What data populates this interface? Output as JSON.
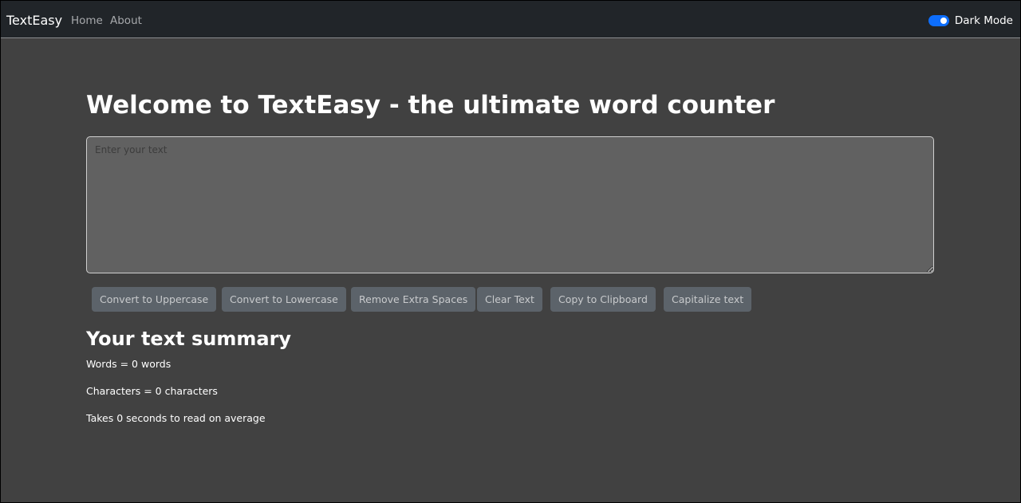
{
  "navbar": {
    "brand": "TextEasy",
    "links": [
      "Home",
      "About"
    ],
    "dark_mode": {
      "label": "Dark Mode",
      "enabled": true
    }
  },
  "main": {
    "title": "Welcome to TextEasy - the ultimate word counter",
    "textarea": {
      "placeholder": "Enter your text",
      "value": ""
    },
    "buttons": [
      "Convert to Uppercase",
      "Convert to Lowercase",
      "Remove Extra Spaces",
      "Clear Text",
      "Copy to Clipboard",
      "Capitalize text"
    ]
  },
  "summary": {
    "title": "Your text summary",
    "words_line": "Words = 0 words",
    "characters_line": "Characters = 0 characters",
    "read_time_line": "Takes 0 seconds to read on average"
  },
  "colors": {
    "page_background": "#414141",
    "navbar_background": "#212529",
    "toggle_accent": "#0d6efd",
    "button_background": "#5c636a",
    "textarea_background": "#616161"
  }
}
